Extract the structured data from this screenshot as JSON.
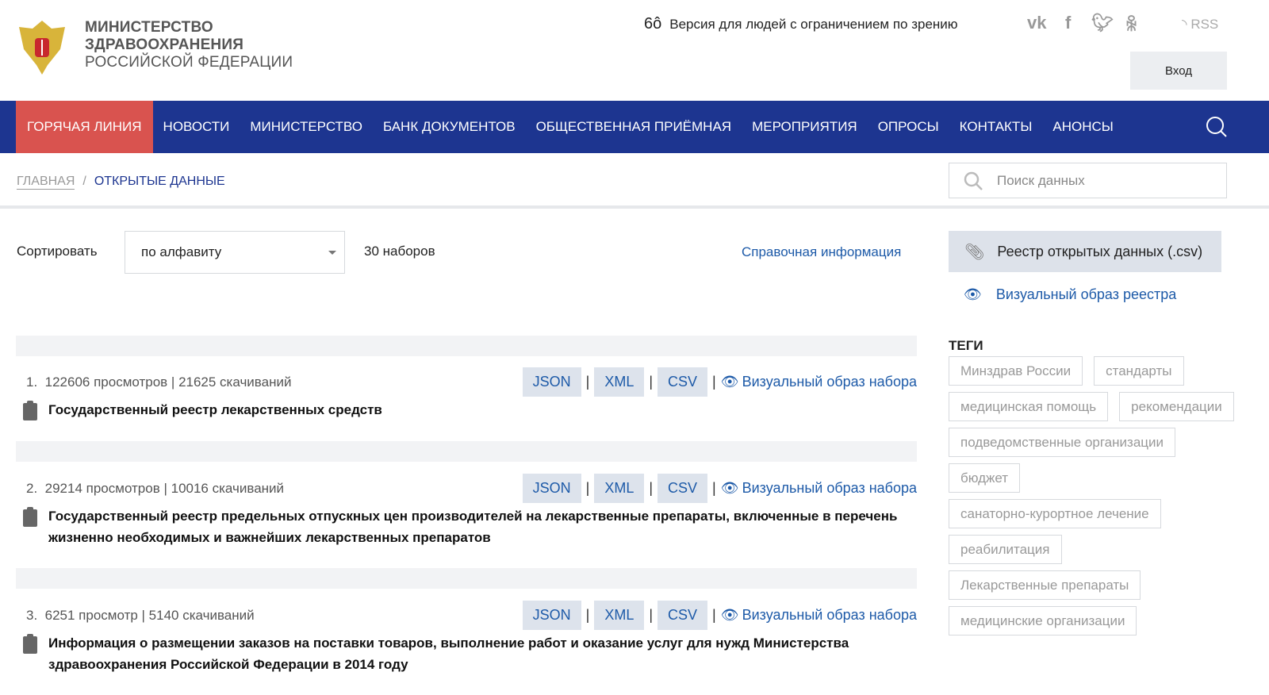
{
  "header": {
    "logo_line1": "МИНИСТЕРСТВО",
    "logo_line2": "ЗДРАВООХРАНЕНИЯ",
    "logo_line3": "РОССИЙСКОЙ ФЕДЕРАЦИИ",
    "accessibility": "Версия для людей с ограничением по зрению",
    "rss": "RSS",
    "login": "Вход"
  },
  "nav": [
    "ГОРЯЧАЯ ЛИНИЯ",
    "НОВОСТИ",
    "МИНИСТЕРСТВО",
    "БАНК ДОКУМЕНТОВ",
    "ОБЩЕСТВЕННАЯ ПРИЁМНАЯ",
    "МЕРОПРИЯТИЯ",
    "ОПРОСЫ",
    "КОНТАКТЫ",
    "АНОНСЫ"
  ],
  "breadcrumb": {
    "home": "ГЛАВНАЯ",
    "sep": "/",
    "current": "ОТКРЫТЫЕ ДАННЫЕ"
  },
  "search": {
    "placeholder": "Поиск данных"
  },
  "toolbar": {
    "sort_label": "Сортировать",
    "sort_value": "по алфавиту",
    "count": "30 наборов",
    "help": "Справочная информация"
  },
  "formats": {
    "json": "JSON",
    "xml": "XML",
    "csv": "CSV",
    "bar": "|",
    "visual": "Визуальный образ набора"
  },
  "items": [
    {
      "num": "1.",
      "stats": "122606 просмотров | 21625 скачиваний",
      "title": "Государственный реестр лекарственных средств"
    },
    {
      "num": "2.",
      "stats": "29214 просмотров | 10016 скачиваний",
      "title": "Государственный реестр предельных отпускных цен производителей на лекарственные препараты, включенные в перечень жизненно необходимых и важнейших лекарственных препаратов"
    },
    {
      "num": "3.",
      "stats": "6251 просмотр | 5140 скачиваний",
      "title": "Информация о размещении заказов на поставки товаров, выполнение работ и оказание услуг для нужд Министерства здравоохранения Российской Федерации в 2014 году"
    }
  ],
  "sidebar": {
    "registry": "Реестр открытых данных (.csv)",
    "visual_registry": "Визуальный образ реестра",
    "tags_title": "ТЕГИ",
    "tags": [
      "Минздрав России",
      "стандарты",
      "медицинская помощь",
      "рекомендации",
      "подведомственные организации",
      "бюджет",
      "санаторно-курортное лечение",
      "реабилитация",
      "Лекарственные препараты",
      "медицинские организации"
    ]
  }
}
